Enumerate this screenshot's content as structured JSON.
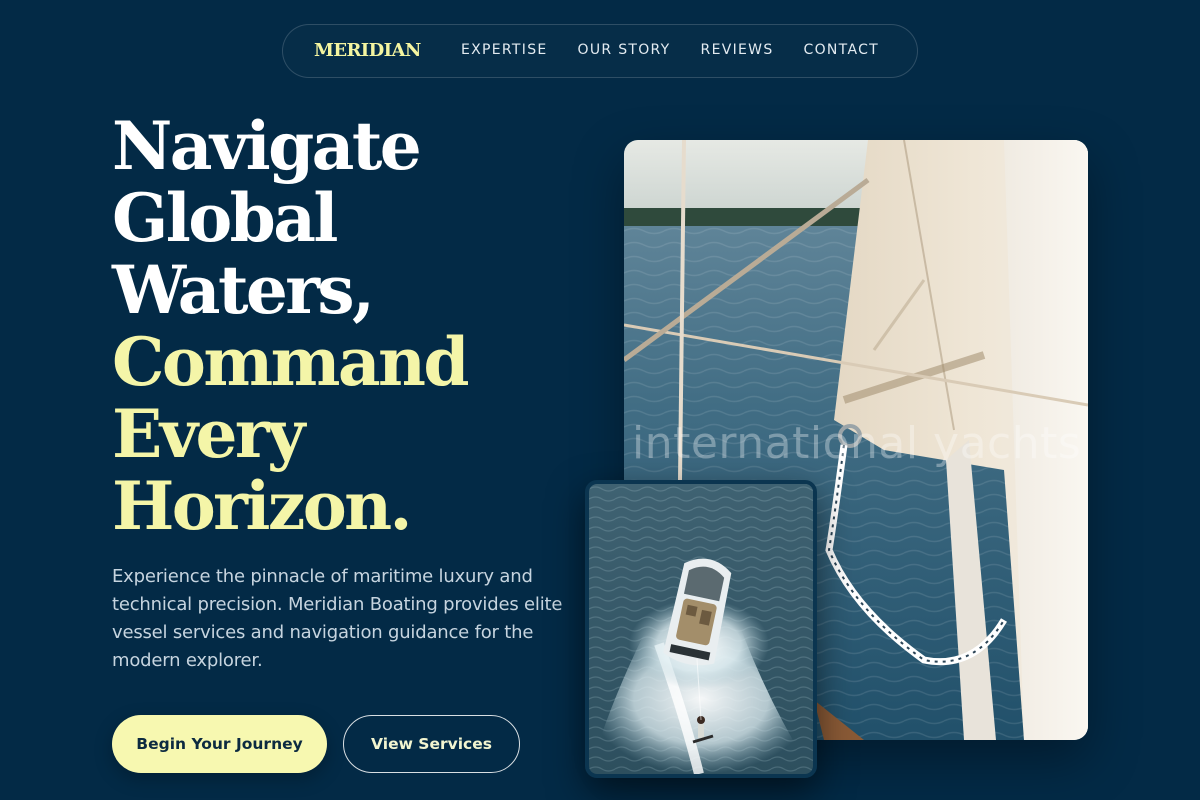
{
  "nav": {
    "brand": "MERIDIAN",
    "links": [
      "EXPERTISE",
      "OUR STORY",
      "REVIEWS",
      "CONTACT"
    ]
  },
  "hero": {
    "headline_white": [
      "Navigate",
      "Global",
      "Waters,"
    ],
    "headline_accent": [
      "Command",
      "Every",
      "Horizon."
    ],
    "description": "Experience the pinnacle of maritime luxury and technical precision. Meridian Boating provides elite vessel services and navigation guidance for the modern explorer.",
    "primary_cta": "Begin Your Journey",
    "secondary_cta": "View Services"
  },
  "media": {
    "watermark": "international yachts",
    "main_image_icon": "sailboat-sail-photo",
    "inset_image_icon": "speedboat-wakeboarder-photo"
  },
  "colors": {
    "background": "#032a46",
    "accent": "#f4f5a8",
    "primary_button": "#f7f8b0",
    "text_muted": "#c6d4df"
  }
}
